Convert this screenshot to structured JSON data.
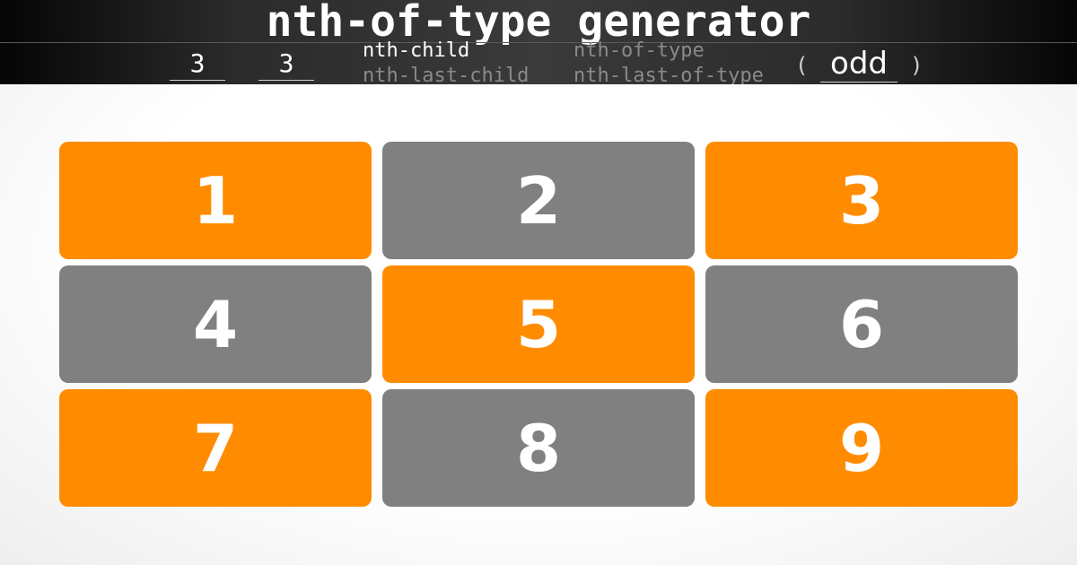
{
  "header": {
    "title": "nth-of-type generator",
    "columns_value": "3",
    "rows_value": "3",
    "selectors": [
      {
        "label": "nth-child",
        "active": true
      },
      {
        "label": "nth-last-child",
        "active": false
      },
      {
        "label": "nth-of-type",
        "active": false
      },
      {
        "label": "nth-last-of-type",
        "active": false
      }
    ],
    "paren_open": "(",
    "paren_close": ")",
    "formula_value": "odd"
  },
  "colors": {
    "match": "#ff8c00",
    "nomatch": "#808080",
    "header_bg": "#2b2b2b"
  },
  "grid": {
    "boxes": [
      {
        "label": "1",
        "matched": true
      },
      {
        "label": "2",
        "matched": false
      },
      {
        "label": "3",
        "matched": true
      },
      {
        "label": "4",
        "matched": false
      },
      {
        "label": "5",
        "matched": true
      },
      {
        "label": "6",
        "matched": false
      },
      {
        "label": "7",
        "matched": true
      },
      {
        "label": "8",
        "matched": false
      },
      {
        "label": "9",
        "matched": true
      }
    ]
  }
}
